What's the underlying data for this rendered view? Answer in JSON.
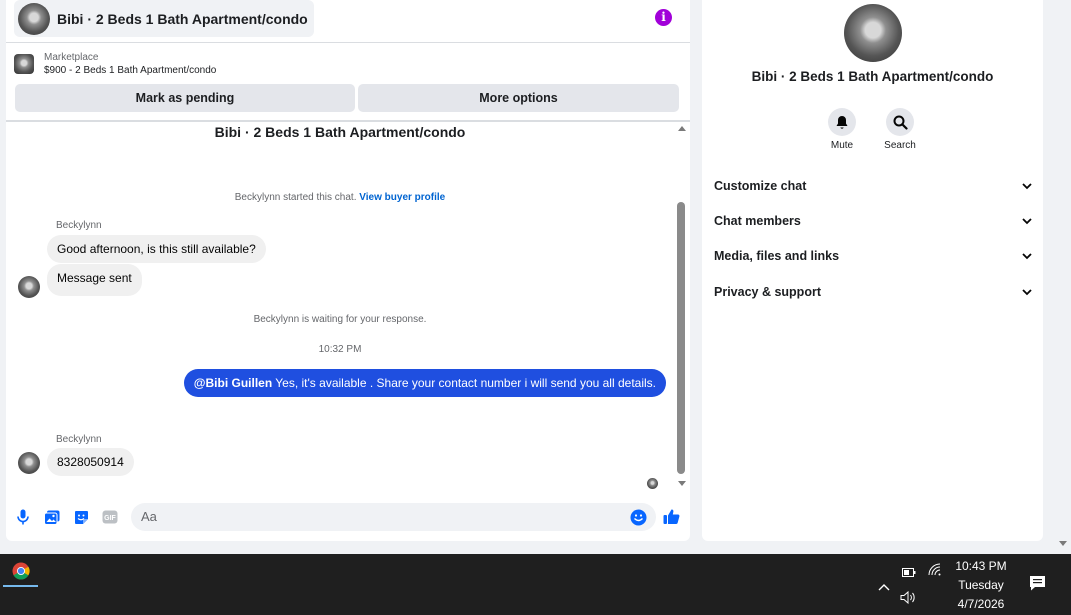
{
  "header": {
    "title": "Bibi · 2 Beds 1 Bath Apartment/condo",
    "info_icon": "info-icon"
  },
  "marketplace": {
    "label": "Marketplace",
    "listing": "$900 - 2 Beds 1 Bath Apartment/condo"
  },
  "actions": {
    "mark_pending": "Mark as pending",
    "more_options": "More options"
  },
  "conversation": {
    "title": "Bibi · 2 Beds 1 Bath Apartment/condo",
    "started_text": "Beckylynn started this chat.",
    "buyer_profile_link": "View buyer profile",
    "messages_1": {
      "sender": "Beckylynn",
      "bubble_1": "Good afternoon, is this still available?",
      "bubble_2": "Message sent"
    },
    "waiting_text": "Beckylynn is waiting for your response.",
    "timestamp": "10:32 PM",
    "outgoing": {
      "mention": "@Bibi Guillen",
      "text": " Yes, it's available . Share your contact number i will send you all details."
    },
    "messages_2": {
      "sender": "Beckylynn",
      "bubble_1": "8328050914"
    }
  },
  "composer": {
    "placeholder": "Aa",
    "icons": [
      "microphone-icon",
      "photo-icon",
      "sticker-icon",
      "gif-icon",
      "emoji-icon",
      "thumbs-up-icon"
    ]
  },
  "info_panel": {
    "title": "Bibi · 2 Beds 1 Bath Apartment/condo",
    "mute_label": "Mute",
    "search_label": "Search",
    "sections": [
      "Customize chat",
      "Chat members",
      "Media, files and links",
      "Privacy & support"
    ]
  },
  "taskbar": {
    "time": "10:43 PM",
    "day": "Tuesday",
    "date": "4/7/2026"
  },
  "colors": {
    "accent": "#1f4fe0",
    "info_purple": "#a100d9",
    "link": "#0064d1"
  }
}
